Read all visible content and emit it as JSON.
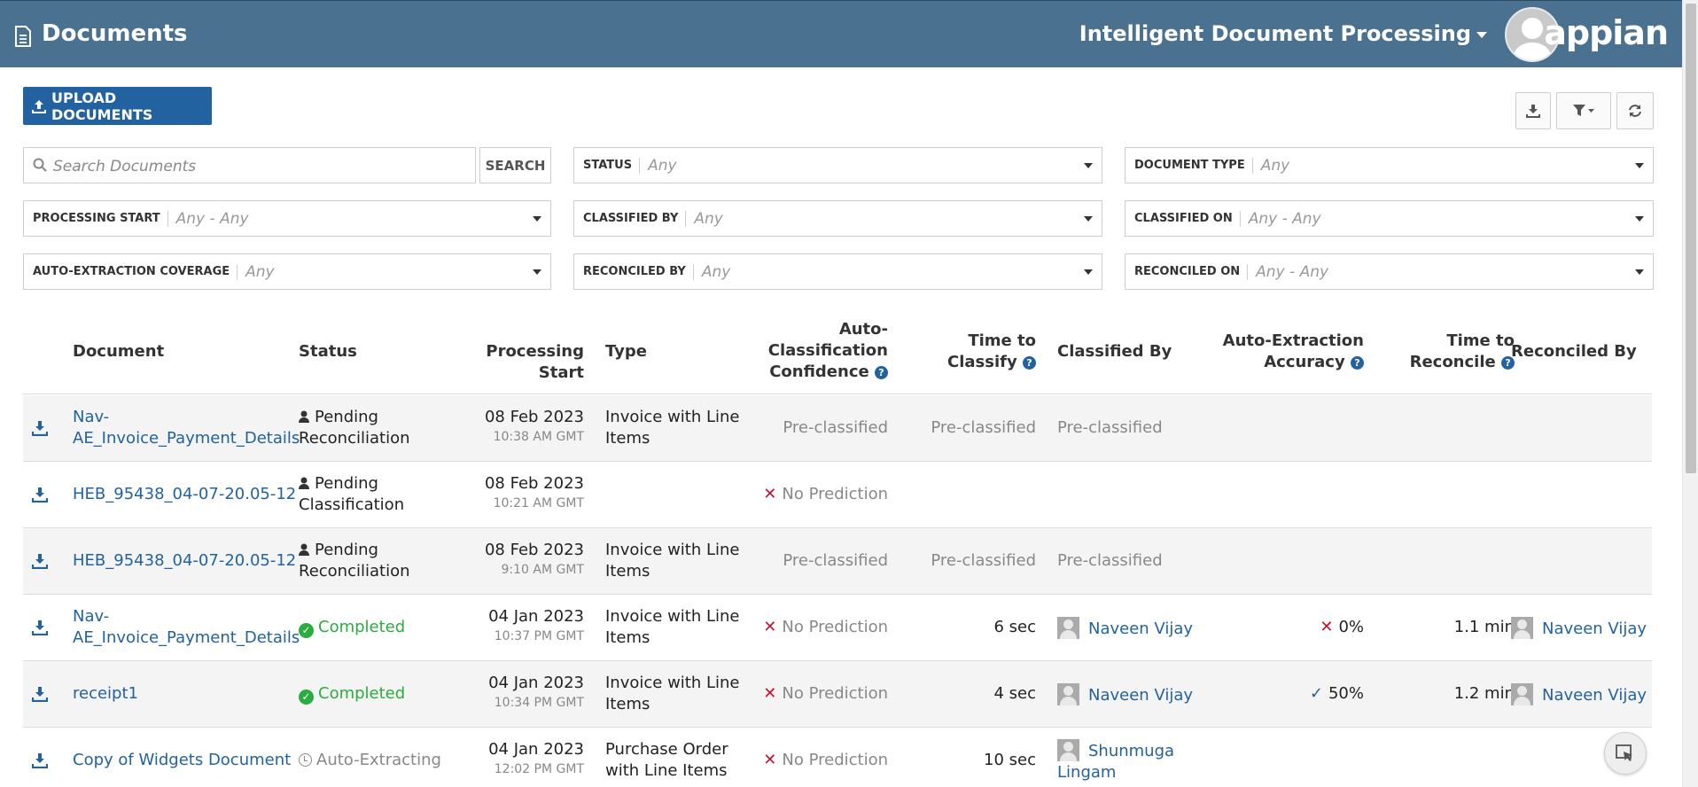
{
  "header": {
    "title": "Documents",
    "app_name": "Intelligent Document Processing",
    "brand": "appian"
  },
  "toolbar": {
    "upload_label": "UPLOAD DOCUMENTS"
  },
  "search": {
    "placeholder": "Search Documents",
    "button_label": "SEARCH"
  },
  "filters": {
    "status": {
      "label": "STATUS",
      "value": "Any"
    },
    "document_type": {
      "label": "DOCUMENT TYPE",
      "value": "Any"
    },
    "processing_start": {
      "label": "PROCESSING START",
      "value": "Any - Any"
    },
    "classified_by": {
      "label": "CLASSIFIED BY",
      "value": "Any"
    },
    "classified_on": {
      "label": "CLASSIFIED ON",
      "value": "Any - Any"
    },
    "auto_extraction_coverage": {
      "label": "AUTO-EXTRACTION COVERAGE",
      "value": "Any"
    },
    "reconciled_by": {
      "label": "RECONCILED BY",
      "value": "Any"
    },
    "reconciled_on": {
      "label": "RECONCILED ON",
      "value": "Any - Any"
    }
  },
  "table": {
    "headers": {
      "document": "Document",
      "status": "Status",
      "processing_start": "Processing Start",
      "type": "Type",
      "confidence_l1": "Auto-",
      "confidence_l2": "Classification",
      "confidence_l3": "Confidence",
      "time_classify_l1": "Time to",
      "time_classify_l2": "Classify",
      "classified_by": "Classified By",
      "accuracy_l1": "Auto-Extraction",
      "accuracy_l2": "Accuracy",
      "time_reconcile_l1": "Time to",
      "time_reconcile_l2": "Reconcile",
      "reconciled_by": "Reconciled By"
    },
    "rows": [
      {
        "doc_l1": "Nav-",
        "doc_l2": "AE_Invoice_Payment_Details",
        "status_l1": "Pending",
        "status_l2": "Reconciliation",
        "date": "08 Feb 2023",
        "time": "10:38 AM GMT",
        "type_l1": "Invoice with Line",
        "type_l2": "Items",
        "confidence": "Pre-classified",
        "time_classify": "Pre-classified",
        "classified_by": "Pre-classified"
      },
      {
        "doc": "HEB_95438_04-07-20.05-12",
        "status_l1": "Pending",
        "status_l2": "Classification",
        "date": "08 Feb 2023",
        "time": "10:21 AM GMT",
        "confidence": "No Prediction"
      },
      {
        "doc": "HEB_95438_04-07-20.05-12",
        "status_l1": "Pending",
        "status_l2": "Reconciliation",
        "date": "08 Feb 2023",
        "time": "9:10 AM GMT",
        "type_l1": "Invoice with Line",
        "type_l2": "Items",
        "confidence": "Pre-classified",
        "time_classify": "Pre-classified",
        "classified_by": "Pre-classified"
      },
      {
        "doc_l1": "Nav-",
        "doc_l2": "AE_Invoice_Payment_Details",
        "status": "Completed",
        "date": "04 Jan 2023",
        "time": "10:37 PM GMT",
        "type_l1": "Invoice with Line",
        "type_l2": "Items",
        "confidence": "No Prediction",
        "time_classify": "6 sec",
        "classified_by": "Naveen Vijay",
        "accuracy": "0%",
        "time_reconcile": "1.1 min",
        "reconciled_by": "Naveen Vijay"
      },
      {
        "doc": "receipt1",
        "status": "Completed",
        "date": "04 Jan 2023",
        "time": "10:34 PM GMT",
        "type_l1": "Invoice with Line",
        "type_l2": "Items",
        "confidence": "No Prediction",
        "time_classify": "4 sec",
        "classified_by": "Naveen Vijay",
        "accuracy": "50%",
        "time_reconcile": "1.2 min",
        "reconciled_by": "Naveen Vijay"
      },
      {
        "doc": "Copy of Widgets Document",
        "status": "Auto-Extracting",
        "date": "04 Jan 2023",
        "time": "12:02 PM GMT",
        "type_l1": "Purchase Order",
        "type_l2": "with Line Items",
        "confidence": "No Prediction",
        "time_classify": "10 sec",
        "classified_by_l1": "Shunmuga",
        "classified_by_l2": "Lingam"
      }
    ]
  },
  "colors": {
    "header_bg": "#4a7190",
    "primary": "#2262a0",
    "success": "#2bac3f",
    "error": "#c8102e"
  }
}
